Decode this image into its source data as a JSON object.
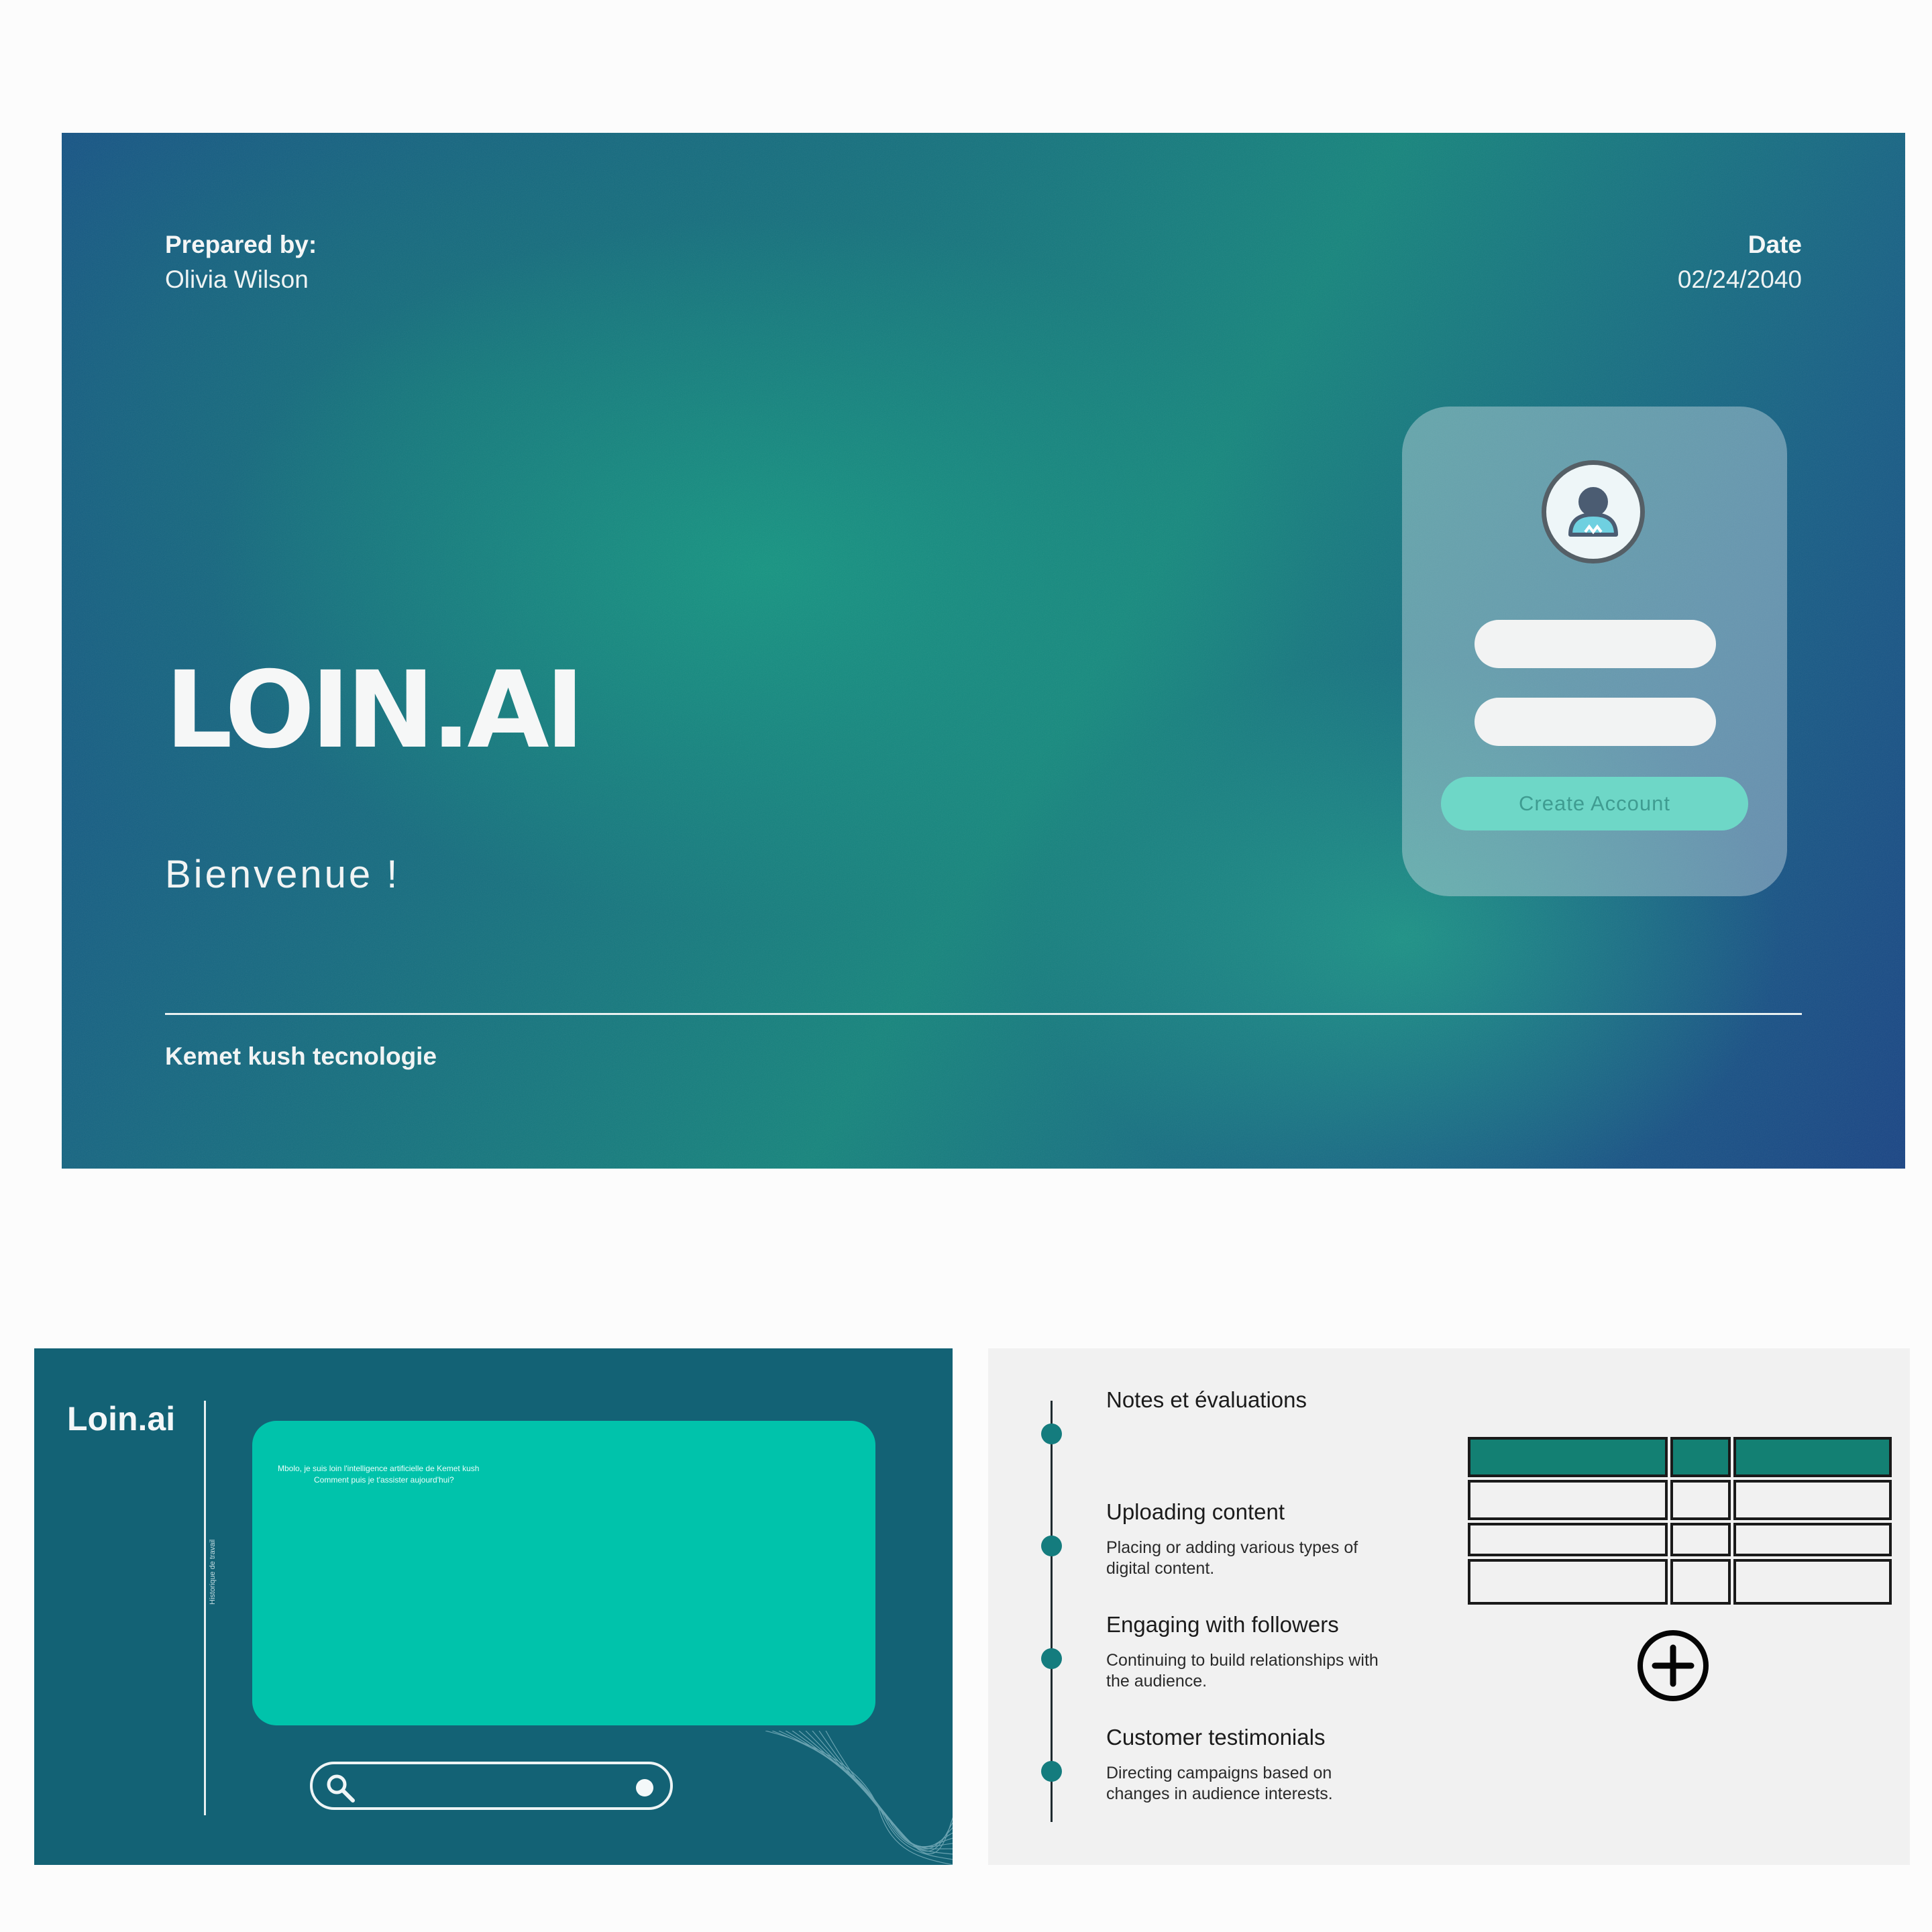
{
  "hero": {
    "prepared_label": "Prepared by:",
    "prepared_name": "Olivia Wilson",
    "date_label": "Date",
    "date_value": "02/24/2040",
    "title": "LOIN.AI",
    "subtitle": "Bienvenue !",
    "company": "Kemet kush tecnologie",
    "login": {
      "avatar_icon": "user-avatar-icon",
      "create_button": "Create Account"
    }
  },
  "chat": {
    "logo": "Loin.ai",
    "sidebar_label": "Historique de travail",
    "message_line1": "Mbolo, je suis loin l'intelligence artificielle de Kemet kush",
    "message_line2": "Comment puis je t'assister aujourd'hui?",
    "search_icon": "search-icon",
    "send_icon": "record-dot-icon"
  },
  "notes": {
    "header": "Notes et évaluations",
    "items": [
      {
        "title": "Uploading content",
        "desc": "Placing or adding various types of digital content."
      },
      {
        "title": "Engaging with followers",
        "desc": "Continuing to build relationships with the audience."
      },
      {
        "title": "Customer testimonials",
        "desc": "Directing campaigns based on changes in audience interests."
      }
    ],
    "add_icon": "plus-circle-icon"
  },
  "colors": {
    "hero_teal": "#16857d",
    "hero_blue": "#174d88",
    "chat_bg": "#136275",
    "chat_box": "#00c3ab",
    "accent_button": "#6ed7c7",
    "table_header": "#138073"
  }
}
